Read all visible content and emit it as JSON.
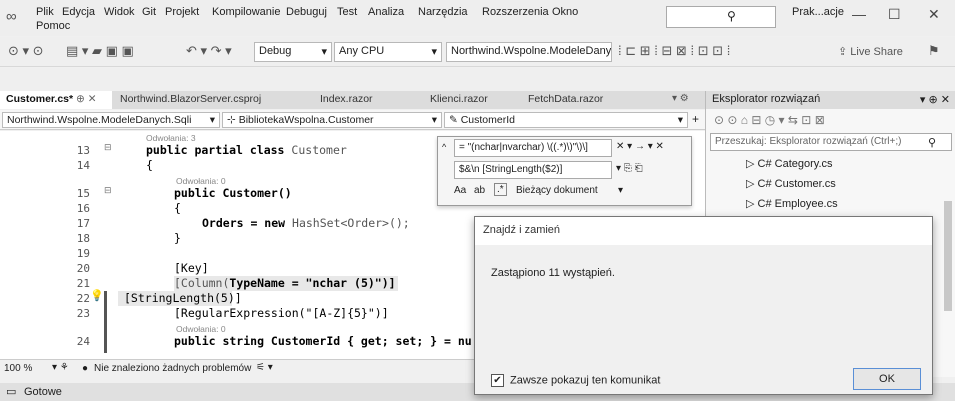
{
  "menubar": {
    "items": [
      "Plik",
      "Edycja",
      "Widok",
      "Git",
      "Projekt",
      "Kompilowanie",
      "Debuguj",
      "Test",
      "Analiza",
      "Narzędzia",
      "Rozszerzenia",
      "Okno"
    ],
    "second_row": "Pomoc",
    "title_short": "Prak...acje",
    "live_share": "Live Share"
  },
  "toolbar": {
    "config": "Debug",
    "platform": "Any CPU",
    "project": "Northwind.Wspolne.ModeleDanycl"
  },
  "tabs": [
    {
      "label": "Customer.cs*",
      "active": true
    },
    {
      "label": "Northwind.BlazorServer.csproj",
      "active": false
    },
    {
      "label": "Index.razor",
      "active": false
    },
    {
      "label": "Klienci.razor",
      "active": false
    },
    {
      "label": "FetchData.razor",
      "active": false
    }
  ],
  "navbar": {
    "project": "Northwind.Wspolne.ModeleDanych.Sqli",
    "class": "BibliotekaWspolna.Customer",
    "member": "CustomerId"
  },
  "code": {
    "refs3": "Odwołania: 3",
    "l13_kw": "public partial class",
    "l13_type": "Customer",
    "l14": "{",
    "refs0a": "Odwołania: 0",
    "l15": "public Customer()",
    "l16": "{",
    "l17a": "Orders = new",
    "l17b": "HashSet<Order>();",
    "l18": "}",
    "l19": "",
    "l20": "[Key]",
    "l21a": "[Column(",
    "l21b": "TypeName = \"nchar (5)\")]",
    "l22": "[StringLength(5)]",
    "l23": "[RegularExpression(\"[A-Z]{5}\")]",
    "refs0b": "Odwołania: 0",
    "l24": "public string CustomerId { get; set; } = nu",
    "line_numbers": [
      "13",
      "14",
      "15",
      "16",
      "17",
      "18",
      "19",
      "20",
      "21",
      "22",
      "23",
      "24"
    ]
  },
  "find": {
    "search": "= \"(nchar|nvarchar) \\((.*)\\)\"\\)\\]",
    "replace": "$&\\n [StringLength($2)]",
    "scope": "Bieżący dokument",
    "aa": "Aa"
  },
  "status": {
    "zoom": "100 %",
    "problems": "Nie znaleziono żadnych problemów"
  },
  "bottom": {
    "ready": "Gotowe"
  },
  "solution": {
    "title": "Eksplorator rozwiązań",
    "search_placeholder": "Przeszukaj: Eksplorator rozwiązań (Ctrl+;)",
    "items": [
      "Category.cs",
      "Customer.cs",
      "Employee.cs"
    ],
    "lang_tag": "C#"
  },
  "dialog": {
    "title": "Znajdź i zamień",
    "message": "Zastąpiono 11 wystąpień.",
    "checkbox": "Zawsze pokazuj ten komunikat",
    "ok": "OK"
  }
}
